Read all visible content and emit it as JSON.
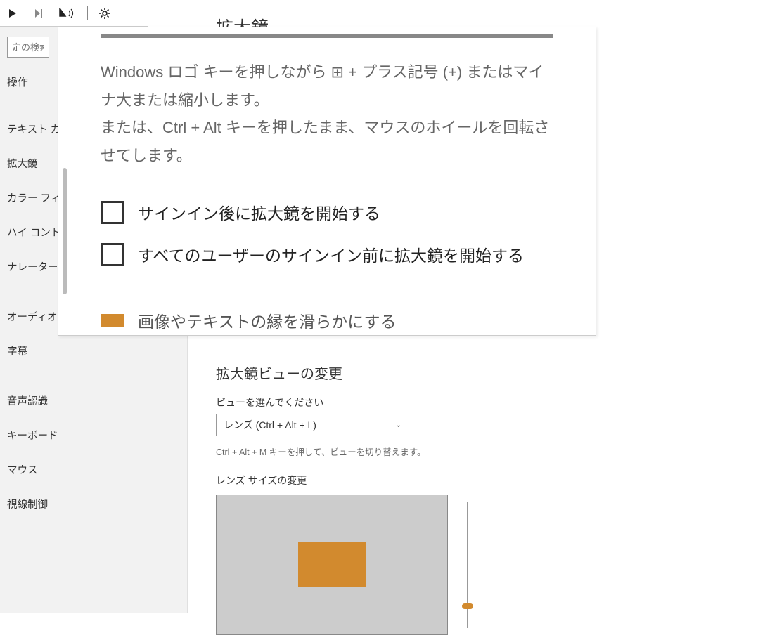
{
  "toolbar": {
    "icons": [
      "play",
      "skip",
      "cursor-sound",
      "gear"
    ]
  },
  "sidebar": {
    "search_placeholder": "定の検索",
    "group_header": "操作",
    "items_a": [
      "テキスト カーソル",
      "拡大鏡",
      "カラー フィルター",
      "ハイ コントラスト",
      "ナレーター"
    ],
    "items_b": [
      "オーディオ",
      "字幕"
    ],
    "items_c": [
      "音声認識",
      "キーボード",
      "マウス",
      "視線制御"
    ]
  },
  "page": {
    "title": "拡大鏡"
  },
  "magnifier": {
    "help1": "Windows ロゴ キーを押しながら ⊞ + プラス記号 (+) またはマイナ大または縮小します。",
    "help2": "または、Ctrl + Alt キーを押したまま、マウスのホイールを回転させてします。",
    "checkbox1": "サインイン後に拡大鏡を開始する",
    "checkbox2": "すべてのユーザーのサインイン前に拡大鏡を開始する",
    "partial": "画像やテキストの縁を滑らかにする"
  },
  "view_section": {
    "title": "拡大鏡ビューの変更",
    "choose_label": "ビューを選んでください",
    "dropdown_value": "レンズ (Ctrl + Alt + L)",
    "help": "Ctrl + Alt + M キーを押して、ビューを切り替えます。",
    "lens_label": "レンズ サイズの変更"
  },
  "colors": {
    "accent": "#d28a2e"
  }
}
